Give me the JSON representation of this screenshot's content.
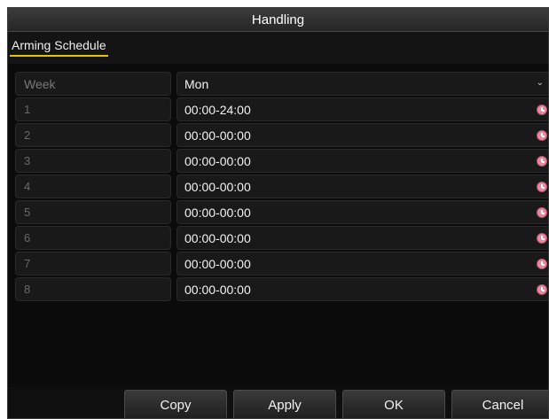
{
  "dialog": {
    "title": "Handling",
    "tabs": [
      {
        "label": "Arming Schedule"
      }
    ]
  },
  "week": {
    "label": "Week",
    "value": "Mon"
  },
  "schedule": [
    {
      "index": "1",
      "time": "00:00-24:00"
    },
    {
      "index": "2",
      "time": "00:00-00:00"
    },
    {
      "index": "3",
      "time": "00:00-00:00"
    },
    {
      "index": "4",
      "time": "00:00-00:00"
    },
    {
      "index": "5",
      "time": "00:00-00:00"
    },
    {
      "index": "6",
      "time": "00:00-00:00"
    },
    {
      "index": "7",
      "time": "00:00-00:00"
    },
    {
      "index": "8",
      "time": "00:00-00:00"
    }
  ],
  "buttons": {
    "copy": "Copy",
    "apply": "Apply",
    "ok": "OK",
    "cancel": "Cancel"
  },
  "icons": {
    "period_icon": "clock-icon",
    "dropdown_icon": "chevron-down-icon"
  },
  "colors": {
    "tab_underline": "#e8c400",
    "clock_icon": "#e68aa0",
    "background": "#0b0b0b"
  }
}
